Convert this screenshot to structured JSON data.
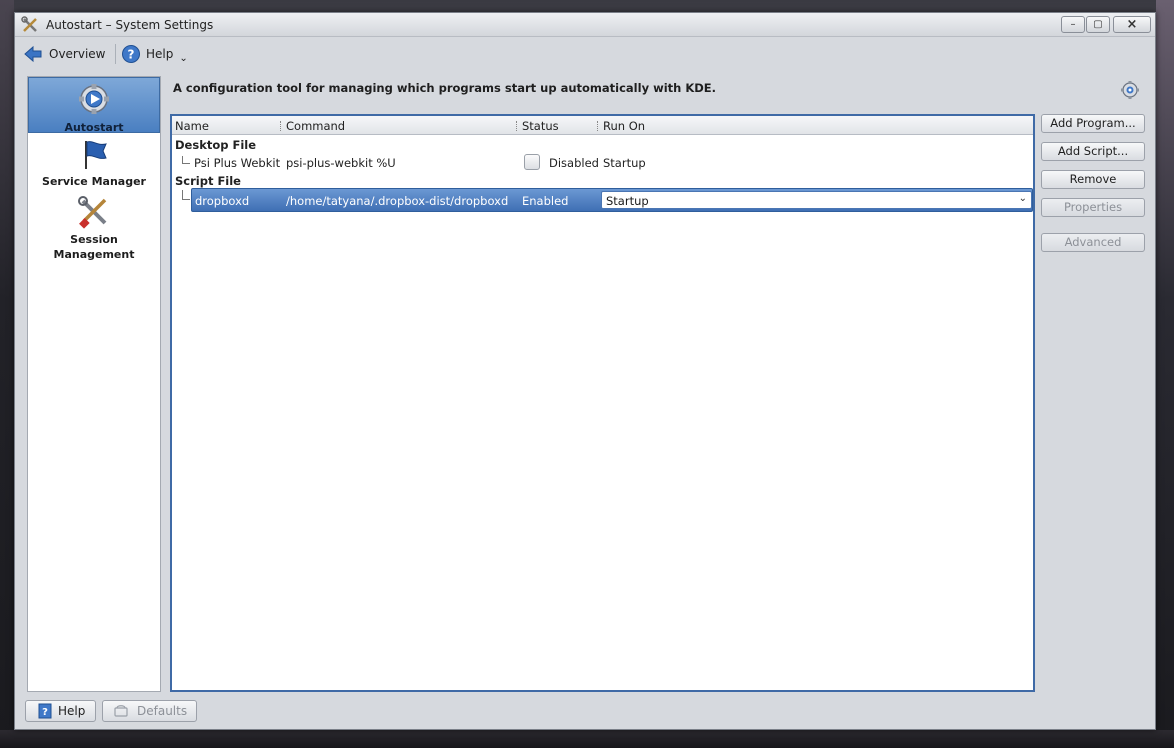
{
  "window": {
    "title": "Autostart – System Settings",
    "minimize_glyph": "–",
    "maximize_glyph": "▢",
    "close_glyph": "×"
  },
  "toolbar": {
    "overview_label": "Overview",
    "help_label": "Help",
    "help_menu_glyph": "⌄"
  },
  "sidebar": {
    "items": [
      {
        "label": "Autostart",
        "icon": "autostart-gear-icon",
        "active": true
      },
      {
        "label": "Service Manager",
        "icon": "flag-icon",
        "active": false
      },
      {
        "label_line1": "Session",
        "label_line2": "Management",
        "icon": "tools-icon",
        "active": false
      }
    ]
  },
  "main": {
    "description": "A configuration tool for managing which programs start up automatically with KDE.",
    "columns": [
      "Name",
      "Command",
      "Status",
      "Run On"
    ],
    "groups": [
      {
        "name": "Desktop File",
        "rows": [
          {
            "name": "Psi Plus Webkit",
            "command": "psi-plus-webkit %U",
            "status": "Disabled",
            "run_on": "Startup",
            "checked": false
          }
        ]
      },
      {
        "name": "Script File",
        "rows": [
          {
            "name": "dropboxd",
            "command": "/home/tatyana/.dropbox-dist/dropboxd",
            "status": "Enabled",
            "run_on": "Startup",
            "selected": true
          }
        ]
      }
    ]
  },
  "actions": {
    "add_program": "Add Program...",
    "add_script": "Add Script...",
    "remove": "Remove",
    "properties": "Properties",
    "advanced": "Advanced"
  },
  "footer": {
    "help_label": "Help",
    "defaults_label": "Defaults"
  },
  "colors": {
    "accent": "#3f6aa6",
    "selection": "#4a7fc1"
  }
}
